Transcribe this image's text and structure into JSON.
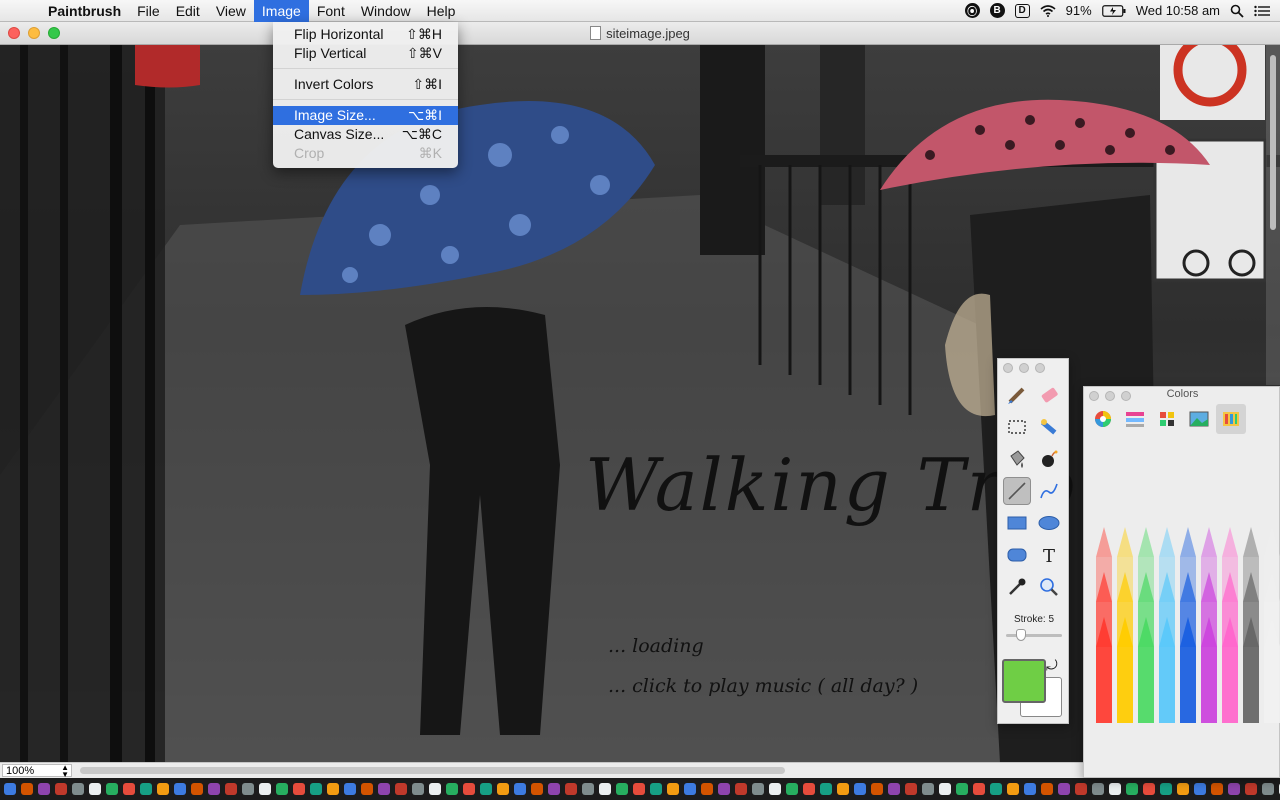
{
  "menubar": {
    "apple_glyph": "",
    "app_name": "Paintbrush",
    "menus": [
      "File",
      "Edit",
      "View",
      "Image",
      "Font",
      "Window",
      "Help"
    ],
    "active_menu": "Image",
    "status": {
      "battery": "91%",
      "clock": "Wed 10:58 am",
      "icons": [
        "alfred-icon",
        "bitdefender-icon",
        "dashlane-icon",
        "wifi-icon",
        "battery-icon",
        "spotlight-icon",
        "notification-center-icon"
      ]
    }
  },
  "window": {
    "title": "siteimage.jpeg",
    "zoom": "100%"
  },
  "image_menu": {
    "items": [
      {
        "label": "Flip Horizontal",
        "shortcut": "⇧⌘H",
        "enabled": true
      },
      {
        "label": "Flip Vertical",
        "shortcut": "⇧⌘V",
        "enabled": true
      },
      {
        "label": "Invert Colors",
        "shortcut": "⇧⌘I",
        "enabled": true
      },
      {
        "label": "Image Size...",
        "shortcut": "⌥⌘I",
        "enabled": true,
        "highlighted": true
      },
      {
        "label": "Canvas Size...",
        "shortcut": "⌥⌘C",
        "enabled": true
      },
      {
        "label": "Crop",
        "shortcut": "⌘K",
        "enabled": false
      }
    ]
  },
  "canvas": {
    "title_text": "Walking Trip",
    "caption_1": "... loading",
    "caption_2": "... click to play music ( all day? )"
  },
  "tools_palette": {
    "tools": [
      "brush-tool",
      "eraser-tool",
      "selection-tool",
      "magic-wand-tool",
      "paint-bucket-tool",
      "spray-tool",
      "line-tool",
      "curve-tool",
      "rectangle-tool",
      "ellipse-tool",
      "rounded-rect-tool",
      "text-tool",
      "eyedropper-tool",
      "zoom-tool"
    ],
    "selected_tool": "line-tool",
    "stroke_label": "Stroke: 5",
    "stroke_value": 5,
    "foreground_color": "#6fce45",
    "background_color": "#ffffff"
  },
  "colors_panel": {
    "title": "Colors",
    "tabs": [
      "color-wheel-tab",
      "sliders-tab",
      "palettes-tab",
      "image-palette-tab",
      "crayons-tab"
    ],
    "selected_tab": "crayons-tab",
    "crayon_colors": [
      "#ff3b30",
      "#ffcc00",
      "#4cd964",
      "#5ac8fa",
      "#1a5fe0",
      "#cc44dd",
      "#ff66cc",
      "#666666",
      "#f0f0f0"
    ]
  },
  "colors": {
    "menu_highlight": "#2f6fe0",
    "accent_green": "#6fce45"
  }
}
